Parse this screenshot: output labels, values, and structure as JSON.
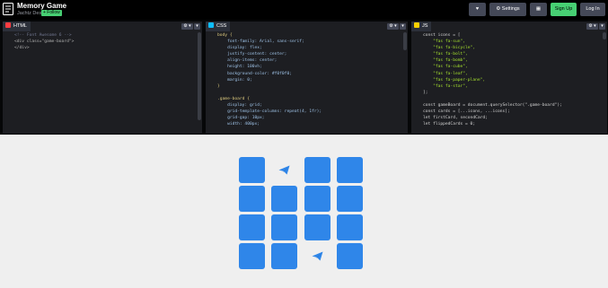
{
  "header": {
    "title": "Memory Game",
    "author": "Jachtz Design",
    "follow_label": "+ Follow",
    "buttons": {
      "heart": "♥",
      "settings": "Settings",
      "layout": "▦",
      "signup": "Sign Up",
      "login": "Log In"
    }
  },
  "editors": {
    "html": {
      "label": "HTML",
      "badge_color": "#ff3c41",
      "lines": [
        "<!-- Font Awesome 6 -->",
        "<div class=\"game-board\">",
        "</div>"
      ]
    },
    "css": {
      "label": "CSS",
      "badge_color": "#0ebeff",
      "lines": [
        "body {",
        "    font-family: Arial, sans-serif;",
        "    display: flex;",
        "    justify-content: center;",
        "    align-items: center;",
        "    height: 100vh;",
        "    background-color: #f0f0f0;",
        "    margin: 0;",
        "}",
        "",
        ".game-board {",
        "    display: grid;",
        "    grid-template-columns: repeat(4, 1fr);",
        "    grid-gap: 10px;",
        "    width: 400px;"
      ]
    },
    "js": {
      "label": "JS",
      "badge_color": "#fcd000",
      "lines": [
        "const icons = [",
        "    \"fas fa-sun\",",
        "    \"fas fa-bicycle\",",
        "    \"fas fa-bolt\",",
        "    \"fas fa-bomb\",",
        "    \"fas fa-cube\",",
        "    \"fas fa-leaf\",",
        "    \"fas fa-paper-plane\",",
        "    \"fas fa-star\",",
        "];",
        "",
        "const gameBoard = document.querySelector(\".game-board\");",
        "const cards = [...icons, ...icons];",
        "let firstCard, secondCard;",
        "let flippedCards = 0;"
      ]
    },
    "pane_tool_gear": "⚙ ▾",
    "pane_tool_collapse": "▾"
  },
  "preview": {
    "background": "#efefef",
    "card_color": "#2f86e9",
    "revealed_icon": "paper-plane-icon",
    "cards": [
      {
        "state": "hidden"
      },
      {
        "state": "revealed"
      },
      {
        "state": "hidden"
      },
      {
        "state": "hidden"
      },
      {
        "state": "hidden"
      },
      {
        "state": "hidden"
      },
      {
        "state": "hidden"
      },
      {
        "state": "hidden"
      },
      {
        "state": "hidden"
      },
      {
        "state": "hidden"
      },
      {
        "state": "hidden"
      },
      {
        "state": "hidden"
      },
      {
        "state": "hidden"
      },
      {
        "state": "hidden"
      },
      {
        "state": "revealed"
      },
      {
        "state": "hidden"
      }
    ]
  }
}
